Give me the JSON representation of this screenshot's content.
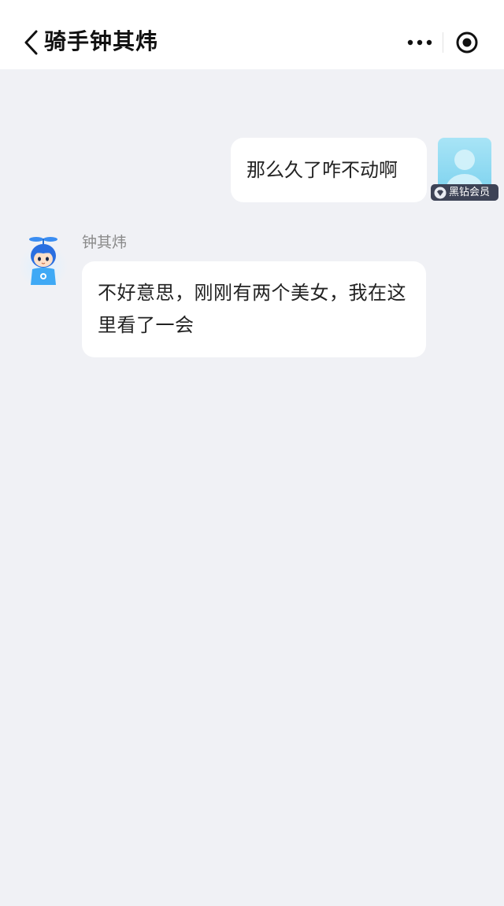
{
  "header": {
    "title": "骑手钟其炜",
    "back_icon": "chevron-left-icon",
    "more_icon": "more-dots-icon",
    "close_icon": "target-circle-icon"
  },
  "messages": [
    {
      "direction": "out",
      "text": "那么久了咋不动啊",
      "badge": "黑钻会员"
    },
    {
      "direction": "in",
      "sender": "钟其炜",
      "text": "不好意思，刚刚有两个美女，我在这里看了一会"
    }
  ],
  "colors": {
    "background": "#f0f1f5",
    "bubble": "#ffffff",
    "badge_bg": "#3d4356",
    "rider_blue": "#2f8ff0"
  }
}
